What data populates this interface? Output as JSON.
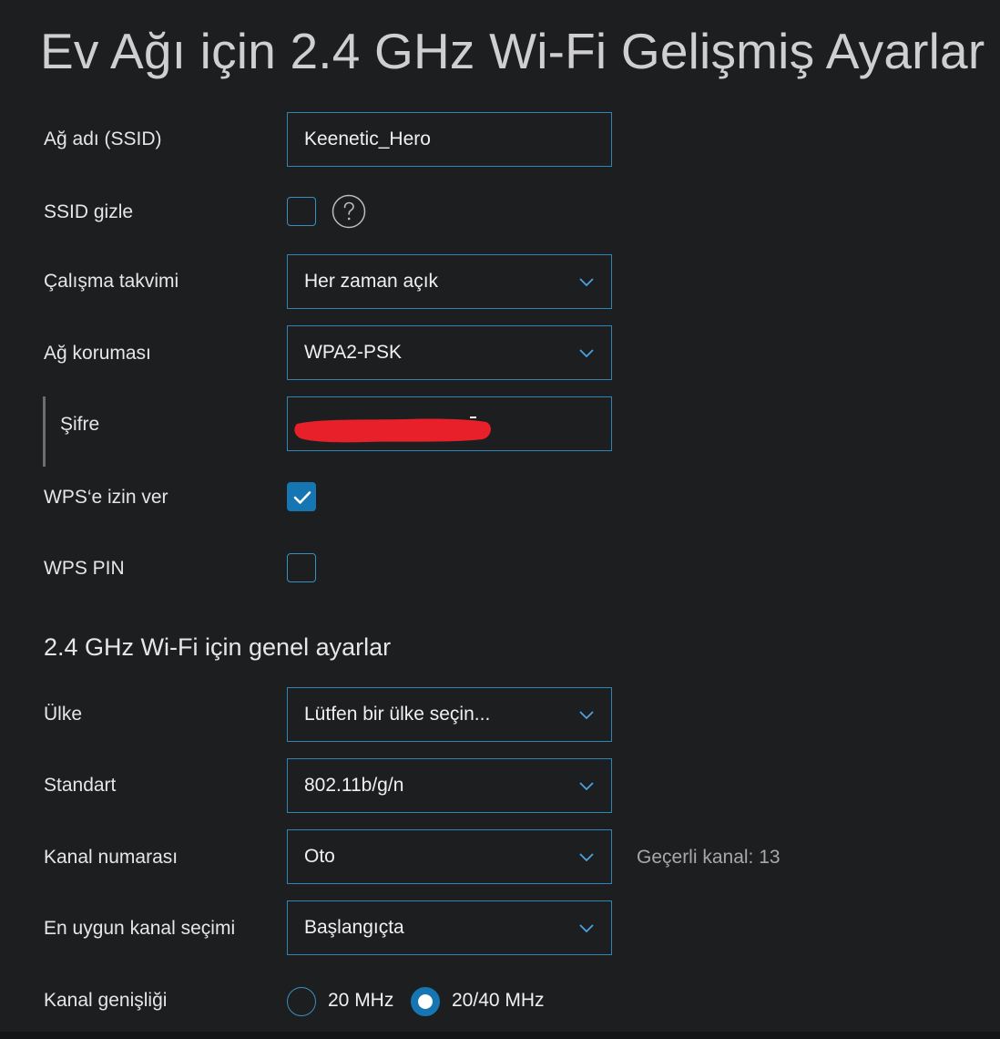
{
  "page": {
    "title": "Ev Ağı için 2.4 GHz Wi-Fi Gelişmiş Ayarlar"
  },
  "fields": {
    "ssid": {
      "label": "Ağ adı (SSID)",
      "value": "Keenetic_Hero"
    },
    "hide_ssid": {
      "label": "SSID gizle",
      "checked": false
    },
    "schedule": {
      "label": "Çalışma takvimi",
      "value": "Her zaman açık"
    },
    "security": {
      "label": "Ağ koruması",
      "value": "WPA2-PSK"
    },
    "password": {
      "label": "Şifre",
      "value": ""
    },
    "wps_allow": {
      "label": "WPS‘e izin ver",
      "checked": true
    },
    "wps_pin": {
      "label": "WPS PIN",
      "checked": false
    }
  },
  "general": {
    "section_title": "2.4 GHz Wi-Fi için genel ayarlar",
    "country": {
      "label": "Ülke",
      "value": "Lütfen bir ülke seçin..."
    },
    "standard": {
      "label": "Standart",
      "value": "802.11b/g/n"
    },
    "channel": {
      "label": "Kanal numarası",
      "value": "Oto",
      "current_channel": "Geçerli kanal: 13"
    },
    "optimal_channel": {
      "label": "En uygun kanal seçimi",
      "value": "Başlangıçta"
    },
    "bandwidth": {
      "label": "Kanal genişliği",
      "options": [
        "20 MHz",
        "20/40 MHz"
      ],
      "selected": "20/40 MHz"
    }
  },
  "icons": {
    "chevron": "chevron-down-icon",
    "help": "help-icon",
    "check": "check-icon"
  },
  "colors": {
    "background": "#1d1e20",
    "accent": "#1676b3",
    "border": "#2f84b8",
    "redaction": "#e8202a"
  }
}
